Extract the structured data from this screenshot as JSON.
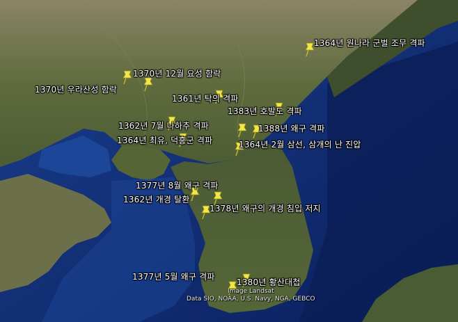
{
  "events": [
    {
      "id": "e1",
      "label": "1364년 원나라 군벌 조무 격파"
    },
    {
      "id": "e2",
      "label": "1370년 12월 요성 함락"
    },
    {
      "id": "e3",
      "label": "1370년 우라산성 함락"
    },
    {
      "id": "e4",
      "label": "1361년 탁의 격파"
    },
    {
      "id": "e5",
      "label": "1383년 호발도 격파"
    },
    {
      "id": "e6",
      "label": "1362년 7월 나하추 격파"
    },
    {
      "id": "e7",
      "label": "1388년 왜구 격파"
    },
    {
      "id": "e8",
      "label": "1364년 최유, 덕흥군 격파"
    },
    {
      "id": "e9",
      "label": "1364년 2월 삼선, 삼개의 난 진압"
    },
    {
      "id": "e10",
      "label": "1377년 8월 왜구 격파"
    },
    {
      "id": "e11",
      "label": "1362년 개경 탈환"
    },
    {
      "id": "e12",
      "label": "1378년 왜구의 개경 침입 저지"
    },
    {
      "id": "e13",
      "label": "1377년 5월 왜구 격파"
    },
    {
      "id": "e14",
      "label": "1380년 황산대첩"
    }
  ],
  "credits": {
    "line1": "Image Landsat",
    "line2": "Data SIO, NOAA, U.S. Navy, NGA, GEBCO"
  },
  "colors": {
    "sea": "#13307a",
    "deep_sea": "#0a1d55",
    "land": "#5a6a3a",
    "land_dark": "#3a4a2a",
    "pin": "#f2e64a"
  }
}
